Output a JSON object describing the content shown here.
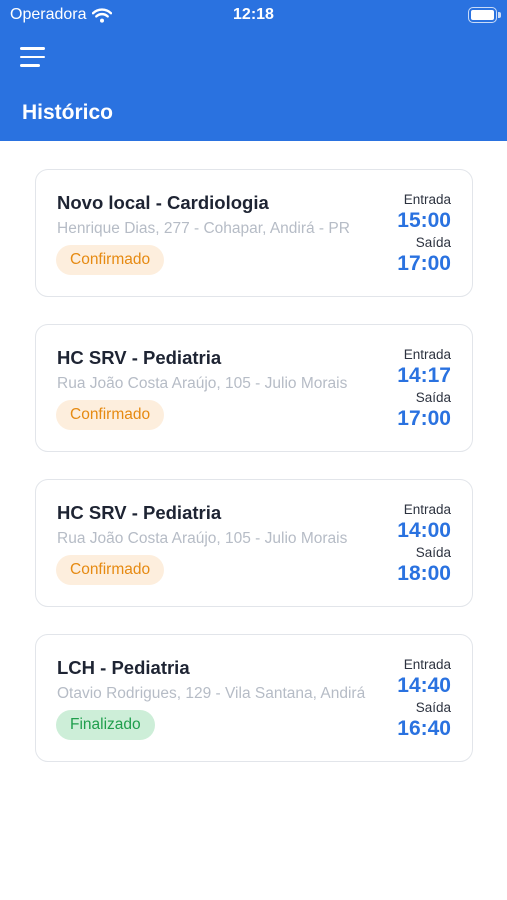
{
  "status_bar": {
    "carrier": "Operadora",
    "time": "12:18"
  },
  "header": {
    "title": "Histórico"
  },
  "labels": {
    "entrada": "Entrada",
    "saida": "Saída"
  },
  "items": [
    {
      "title": "Novo local - Cardiologia",
      "address": "Henrique Dias, 277 - Cohapar, Andirá - PR",
      "status": "Confirmado",
      "entrada": "15:00",
      "saida": "17:00"
    },
    {
      "title": "HC SRV - Pediatria",
      "address": "Rua João Costa Araújo, 105 - Julio Morais",
      "status": "Confirmado",
      "entrada": "14:17",
      "saida": "17:00"
    },
    {
      "title": "HC SRV - Pediatria",
      "address": "Rua João Costa Araújo, 105 - Julio Morais",
      "status": "Confirmado",
      "entrada": "14:00",
      "saida": "18:00"
    },
    {
      "title": "LCH - Pediatria",
      "address": "Otavio Rodrigues, 129 - Vila Santana, Andirá",
      "status": "Finalizado",
      "entrada": "14:40",
      "saida": "16:40"
    }
  ],
  "colors": {
    "primary": "#2a72e0",
    "confirmado_bg": "#fdeedd",
    "confirmado_fg": "#e68a12",
    "finalizado_bg": "#cdeed8",
    "finalizado_fg": "#1f9e4c"
  },
  "icons": {
    "menu": "hamburger-menu-icon",
    "wifi": "wifi-icon",
    "battery": "battery-icon"
  }
}
